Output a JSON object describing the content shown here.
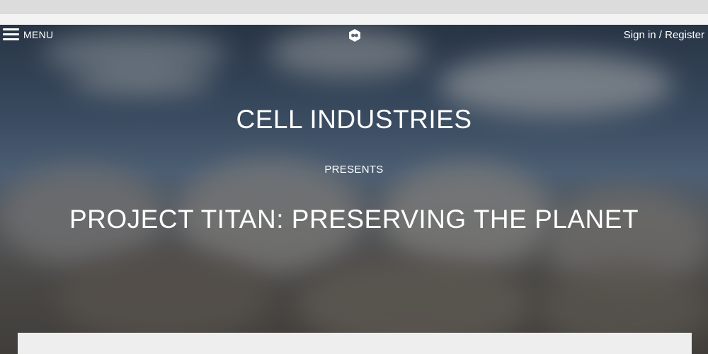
{
  "nav": {
    "menu_label": "MENU",
    "signin_label": "Sign in / Register",
    "logo_icon": "cell-hexagon-logo-icon"
  },
  "hero": {
    "title": "CELL INDUSTRIES",
    "presents": "PRESENTS",
    "subtitle": "PROJECT TITAN: PRESERVING THE PLANET"
  },
  "colors": {
    "text": "#ffffff",
    "sky": "#455d7a",
    "card": "#eeeeee"
  }
}
